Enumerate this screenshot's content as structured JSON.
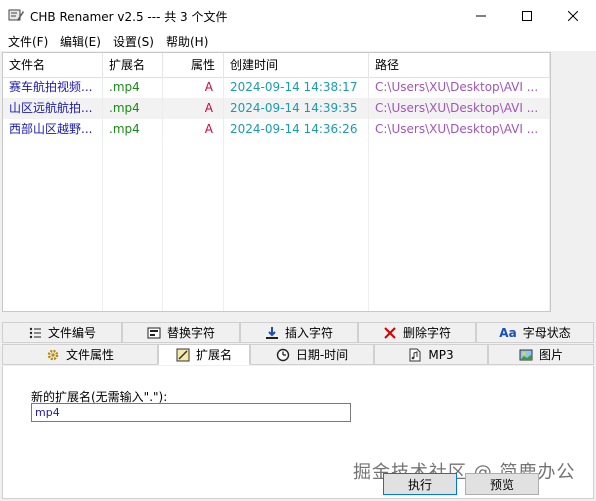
{
  "window": {
    "title": "CHB Renamer v2.5 --- 共 3 个文件",
    "minimize": "—",
    "maximize": "☐",
    "close": "✕"
  },
  "menu": [
    {
      "label": "文件(F)"
    },
    {
      "label": "编辑(E)"
    },
    {
      "label": "设置(S)"
    },
    {
      "label": "帮助(H)"
    }
  ],
  "list": {
    "columns": [
      "文件名",
      "扩展名",
      "属性",
      "创建时间",
      "路径"
    ],
    "rows": [
      {
        "name": "赛车航拍视频...",
        "ext": ".mp4",
        "attr": "A",
        "created": "2024-09-14 14:38:17",
        "path": "C:\\Users\\XU\\Desktop\\AVI ..."
      },
      {
        "name": "山区远航航拍...",
        "ext": ".mp4",
        "attr": "A",
        "created": "2024-09-14 14:39:35",
        "path": "C:\\Users\\XU\\Desktop\\AVI ..."
      },
      {
        "name": "西部山区越野...",
        "ext": ".mp4",
        "attr": "A",
        "created": "2024-09-14 14:36:26",
        "path": "C:\\Users\\XU\\Desktop\\AVI ..."
      }
    ]
  },
  "tabs_row1": [
    {
      "label": "文件编号",
      "icon": "list-numbered-icon"
    },
    {
      "label": "替换字符",
      "icon": "replace-icon"
    },
    {
      "label": "插入字符",
      "icon": "insert-arrow-icon"
    },
    {
      "label": "删除字符",
      "icon": "delete-x-icon"
    },
    {
      "label": "字母状态",
      "icon": "letter-case-icon"
    }
  ],
  "tabs_row2": [
    {
      "label": "文件属性",
      "icon": "gear-icon"
    },
    {
      "label": "扩展名",
      "icon": "extension-icon",
      "active": true
    },
    {
      "label": "日期-时间",
      "icon": "clock-icon"
    },
    {
      "label": "MP3",
      "icon": "mp3-file-icon"
    },
    {
      "label": "图片",
      "icon": "picture-icon"
    }
  ],
  "panel": {
    "ext_label": "新的扩展名(无需输入\".\"):",
    "ext_value": "mp4"
  },
  "buttons": {
    "execute": "执行",
    "preview": "预览"
  },
  "watermark": "掘金技术社区 @ 简鹿办公",
  "colors": {
    "name": "#1a1ab4",
    "ext": "#1a8a1a",
    "attr": "#d4003a",
    "time": "#1a9bb0",
    "path": "#a056b8"
  }
}
